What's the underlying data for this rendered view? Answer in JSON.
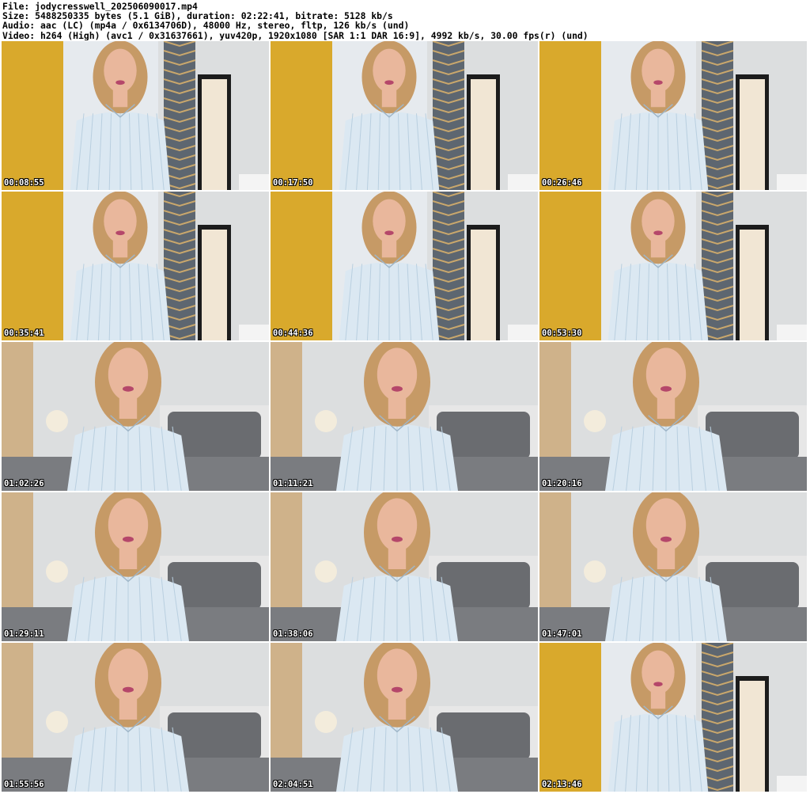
{
  "header": {
    "file_line": "File: jodycresswell_202506090017.mp4",
    "size_line": "Size: 5488250335 bytes (5.1 GiB), duration: 02:22:41, bitrate: 5128 kb/s",
    "audio_line": "Audio: aac (LC) (mp4a / 0x6134706D), 48000 Hz, stereo, fltp, 126 kb/s (und)",
    "video_line": "Video: h264 (High) (avc1 / 0x31637661), yuv420p, 1920x1080 [SAR 1:1 DAR 16:9], 4992 kb/s, 30.00 fps(r) (und)"
  },
  "thumbnails": [
    {
      "timestamp": "00:08:55",
      "scene": "standing"
    },
    {
      "timestamp": "00:17:50",
      "scene": "standing"
    },
    {
      "timestamp": "00:26:46",
      "scene": "standing"
    },
    {
      "timestamp": "00:35:41",
      "scene": "standing"
    },
    {
      "timestamp": "00:44:36",
      "scene": "standing"
    },
    {
      "timestamp": "00:53:30",
      "scene": "standing"
    },
    {
      "timestamp": "01:02:26",
      "scene": "seated"
    },
    {
      "timestamp": "01:11:21",
      "scene": "seated"
    },
    {
      "timestamp": "01:20:16",
      "scene": "seated"
    },
    {
      "timestamp": "01:29:11",
      "scene": "seated"
    },
    {
      "timestamp": "01:38:06",
      "scene": "seated"
    },
    {
      "timestamp": "01:47:01",
      "scene": "seated"
    },
    {
      "timestamp": "01:55:56",
      "scene": "seated"
    },
    {
      "timestamp": "02:04:51",
      "scene": "seated"
    },
    {
      "timestamp": "02:13:46",
      "scene": "standing"
    }
  ],
  "colors": {
    "wall": "#dcdedf",
    "curtain_yellow": "#d9a92c",
    "curtain_pattern": "#5d6670",
    "mirror_frame": "#1c1c1c",
    "shirt": "#dbe8f2",
    "skin": "#e9b79c",
    "hair": "#c69a66",
    "bed_gray": "#6a6c70"
  }
}
